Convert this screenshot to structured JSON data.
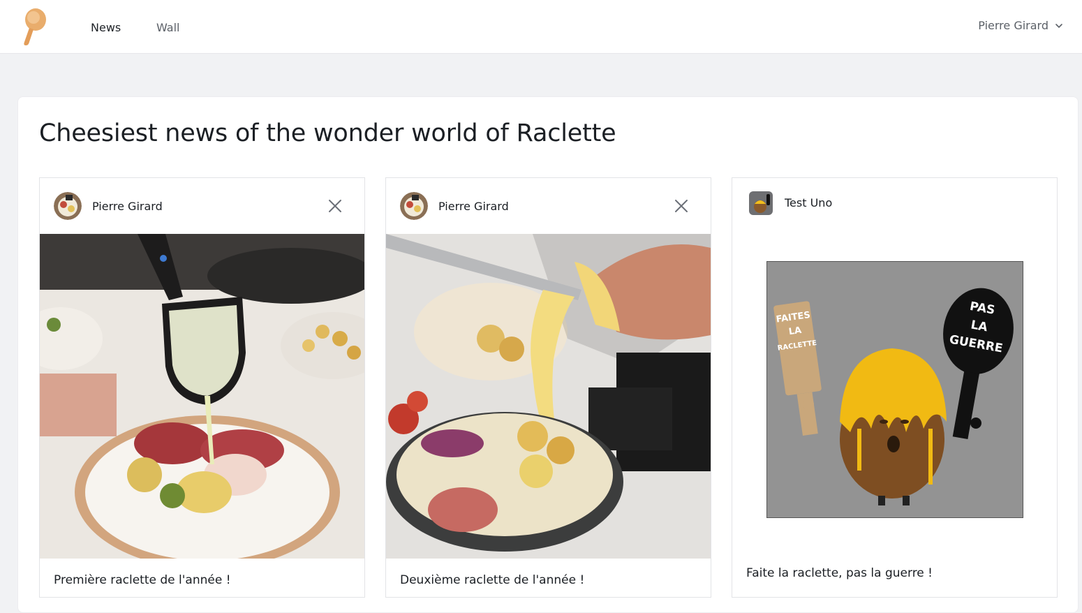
{
  "header": {
    "nav": [
      {
        "label": "News"
      },
      {
        "label": "Wall"
      }
    ],
    "user": {
      "name": "Pierre Girard"
    }
  },
  "page": {
    "title": "Cheesiest news of the wonder world of Raclette"
  },
  "posts": [
    {
      "author": "Pierre Girard",
      "caption": "Première raclette de l'année !",
      "deletable": true
    },
    {
      "author": "Pierre Girard",
      "caption": "Deuxième raclette de l'année !",
      "deletable": true
    },
    {
      "author": "Test Uno",
      "caption": "Faite la raclette, pas la guerre !",
      "deletable": false
    }
  ],
  "poster": {
    "sign_left": [
      "FAITES",
      "LA",
      "RACLETTE"
    ],
    "sign_right": [
      "PAS",
      "LA",
      "GUERRE"
    ]
  },
  "colors": {
    "accent": "#e7a865",
    "background": "#f1f2f4",
    "panel": "#ffffff"
  },
  "icons": {
    "logo": "raclette-spatula-icon",
    "dropdown": "chevron-down-icon",
    "delete": "close-icon"
  }
}
